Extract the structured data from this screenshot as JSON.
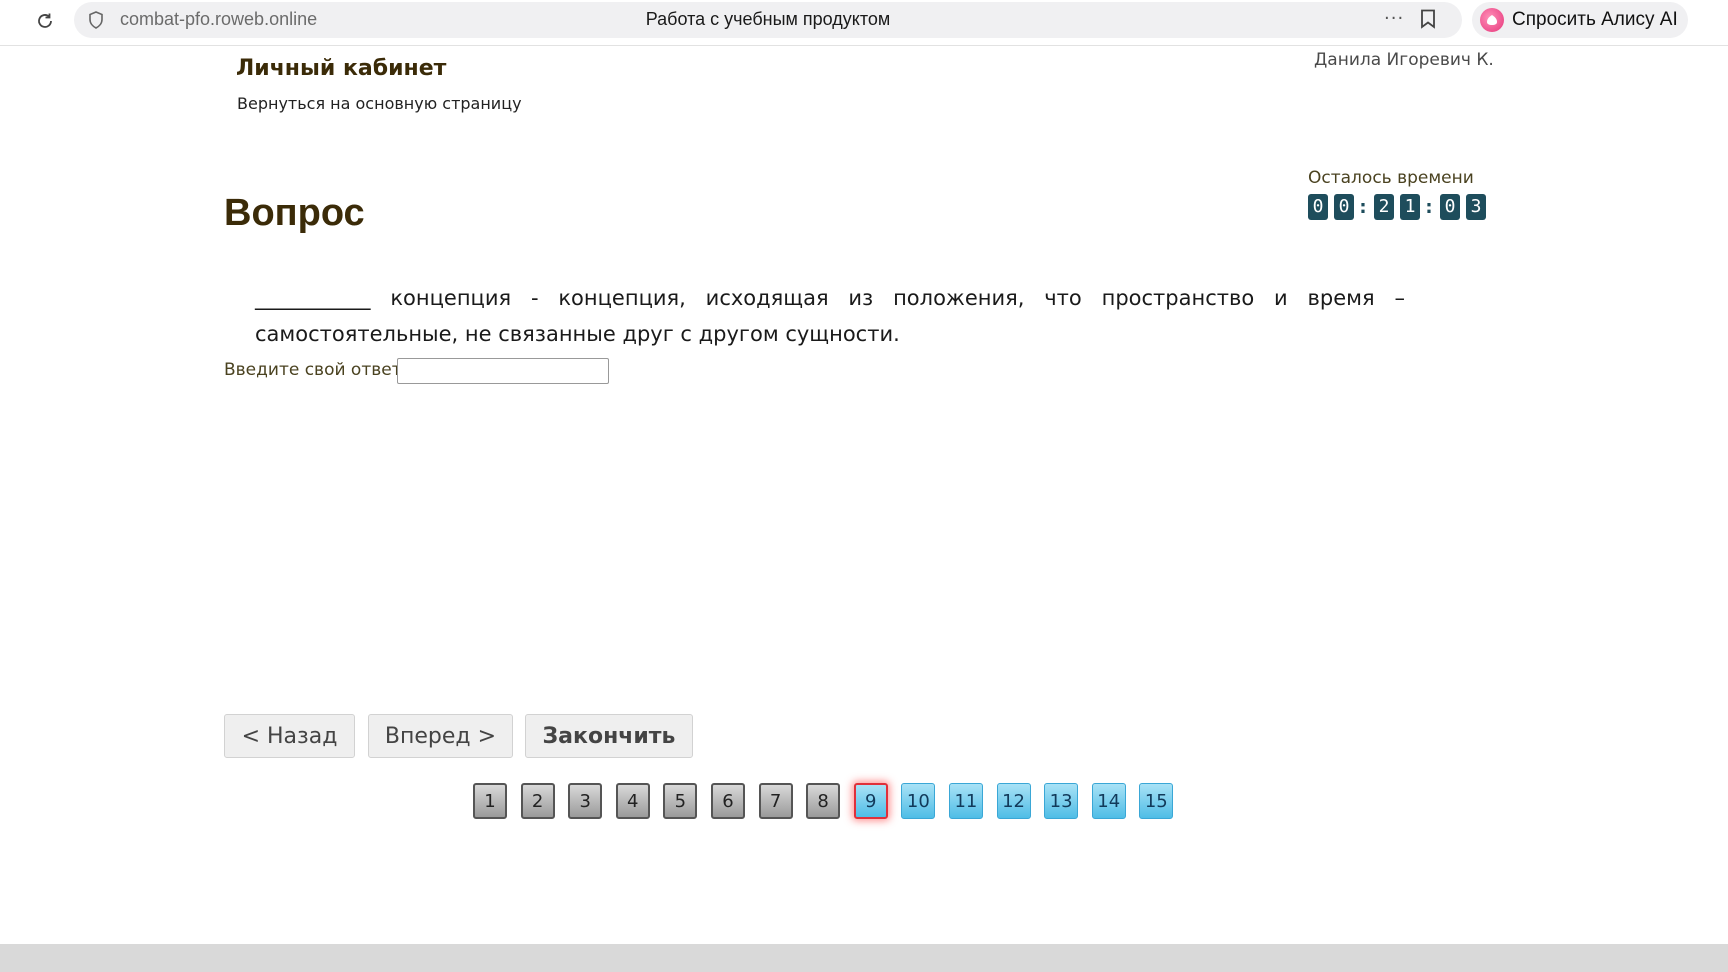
{
  "browser": {
    "url": "combat-pfo.roweb.online",
    "page_title": "Работа с учебным продуктом",
    "alice_label": "Спросить Алису AI",
    "menu_dots": "···"
  },
  "header": {
    "title": "Личный кабинет",
    "back_link": "Вернуться на основную страницу",
    "user_name": "Данила Игоревич К."
  },
  "timer": {
    "label": "Осталось времени",
    "digits": [
      "0",
      "0",
      "2",
      "1",
      "0",
      "3"
    ],
    "separator": ":"
  },
  "question": {
    "heading": "Вопрос",
    "text": "___________ концепция - концепция, исходящая из положения, что пространство и время – самостоятельные, не связанные друг с другом сущности.",
    "answer_label": "Введите свой ответ",
    "answer_value": ""
  },
  "navigation": {
    "back": "< Назад",
    "forward": "Вперед >",
    "finish": "Закончить"
  },
  "pager": {
    "pages": [
      "1",
      "2",
      "3",
      "4",
      "5",
      "6",
      "7",
      "8",
      "9",
      "10",
      "11",
      "12",
      "13",
      "14",
      "15"
    ],
    "current": "9",
    "answered_through": 8
  },
  "colors": {
    "heading": "#3b2b08",
    "timer_digit_bg": "#1e4d5c",
    "page_done_border": "#555555",
    "page_todo": "#4fbde6",
    "page_current_border": "#e0303a"
  }
}
